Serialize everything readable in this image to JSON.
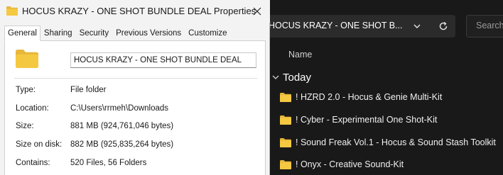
{
  "explorer": {
    "address": "HOCUS KRAZY - ONE SHOT B...",
    "search_placeholder": "Search H",
    "column_name": "Name",
    "group_label": "Today",
    "files": [
      "! HZRD 2.0 - Hocus & Genie Multi-Kit",
      "! Cyber - Experimental One Shot-Kit",
      "! Sound Freak Vol.1 - Hocus & Sound Stash Toolkit",
      "! Onyx - Creative Sound-Kit"
    ],
    "colors": {
      "background": "#191919",
      "folder": "#f5c842"
    }
  },
  "dialog": {
    "title": "HOCUS KRAZY - ONE SHOT BUNDLE DEAL Properties",
    "tabs": [
      "General",
      "Sharing",
      "Security",
      "Previous Versions",
      "Customize"
    ],
    "active_tab": "General",
    "name_value": "HOCUS KRAZY - ONE SHOT BUNDLE DEAL",
    "properties": {
      "type_label": "Type:",
      "type_value": "File folder",
      "location_label": "Location:",
      "location_value": "C:\\Users\\rrmeh\\Downloads",
      "size_label": "Size:",
      "size_value": "881 MB (924,761,046 bytes)",
      "size_on_disk_label": "Size on disk:",
      "size_on_disk_value": "882 MB (925,835,264 bytes)",
      "contains_label": "Contains:",
      "contains_value": "520 Files, 56 Folders"
    },
    "icons": {
      "title": "folder-icon",
      "close": "close-icon",
      "large": "folder-icon"
    }
  }
}
